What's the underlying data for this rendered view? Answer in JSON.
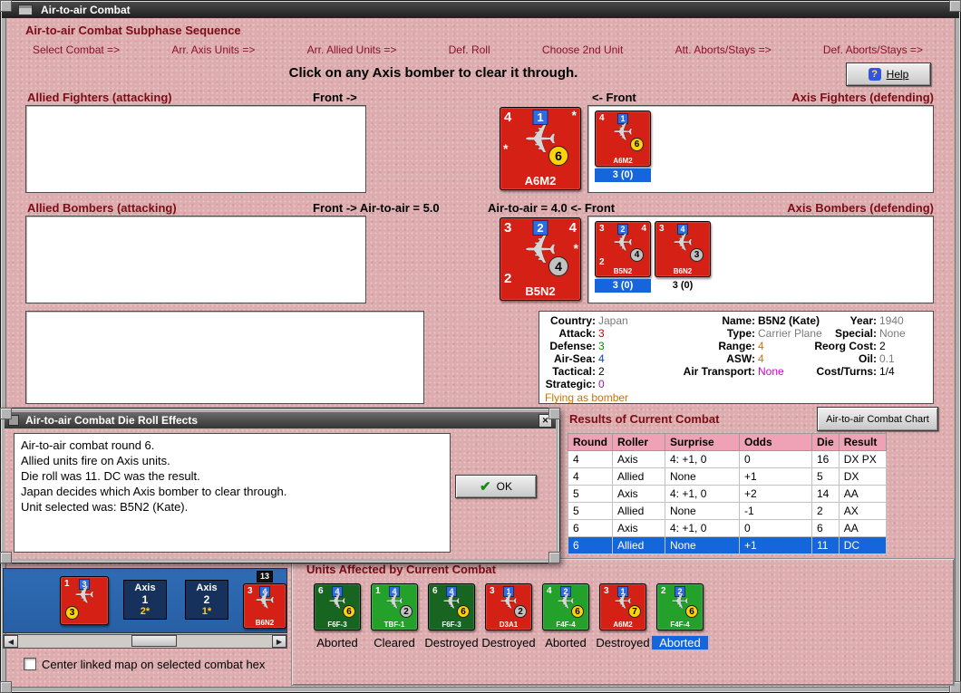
{
  "window": {
    "title": "Air-to-air Combat"
  },
  "colors": {
    "background_pink": "#dcacae",
    "maroon_text": "#7c0c16",
    "counter_red": "#d52015",
    "counter_green": "#23a12b",
    "counter_dark_green": "#176520",
    "marker_navy": "#16325c",
    "highlight_blue": "#1565dd",
    "table_header_pink": "#efa2b6",
    "circle_yellow": "#ffd20a",
    "circle_gray": "#c2c2c2",
    "stat_box_blue": "#2e6ce0",
    "map_blue": "#2d68b0"
  },
  "subphase": {
    "title": "Air-to-air Combat Subphase Sequence",
    "steps": [
      "Select Combat =>",
      "Arr. Axis Units =>",
      "Arr. Allied Units =>",
      "Def. Roll",
      "Choose 2nd Unit",
      "Att. Aborts/Stays =>",
      "Def. Aborts/Stays =>"
    ]
  },
  "banner": {
    "instruction": "Click on any Axis bomber to clear it through.",
    "help_label": "Help"
  },
  "fighter_row": {
    "allied_label": "Allied Fighters (attacking)",
    "front_label": "Front ->",
    "front_label_right": "<- Front",
    "axis_label": "Axis Fighters (defending)",
    "large_counter": {
      "name": "A6M2",
      "tl": "4",
      "box": "1",
      "circle": "6",
      "star": "*"
    },
    "axis_list": [
      {
        "name": "A6M2",
        "tl": "4",
        "box": "1",
        "circle": "6",
        "caption": "3 (0)",
        "selected": true
      }
    ]
  },
  "bomber_row": {
    "allied_label": "Allied Bombers (attacking)",
    "front_label": "Front ->  Air-to-air = 5.0",
    "front_label_right": "Air-to-air = 4.0  <- Front",
    "axis_label": "Axis Bombers (defending)",
    "large_counter": {
      "name": "B5N2",
      "tl": "3",
      "box": "2",
      "tr": "4",
      "bl": "2",
      "circle": "4",
      "star": "*"
    },
    "axis_list": [
      {
        "name": "B5N2",
        "tl": "3",
        "box": "2",
        "tr": "4",
        "bl": "2",
        "circle": "4",
        "caption": "3 (0)",
        "selected": true
      },
      {
        "name": "B6N2",
        "tl": "3",
        "box": "4",
        "circle": "3",
        "caption": "3 (0)",
        "selected": false
      }
    ]
  },
  "unit_info": {
    "col1": [
      {
        "label": "Country:",
        "value": "Japan",
        "color": "gray"
      },
      {
        "label": "Attack:",
        "value": "3",
        "color": "red"
      },
      {
        "label": "Defense:",
        "value": "3",
        "color": "green"
      },
      {
        "label": "Air-Sea:",
        "value": "4",
        "color": "blue"
      },
      {
        "label": "Tactical:",
        "value": "2",
        "color": "black"
      },
      {
        "label": "Strategic:",
        "value": "0",
        "color": "purple"
      }
    ],
    "col2": [
      {
        "label": "Name:",
        "value": "B5N2 (Kate)",
        "color": "bold"
      },
      {
        "label": "Type:",
        "value": "Carrier Plane",
        "color": "gray"
      },
      {
        "label": "Range:",
        "value": "4",
        "color": "orange"
      },
      {
        "label": "ASW:",
        "value": "4",
        "color": "orange"
      },
      {
        "label": "Air Transport:",
        "value": "None",
        "color": "magenta"
      }
    ],
    "col3": [
      {
        "label": "Year:",
        "value": "1940",
        "color": "gray"
      },
      {
        "label": "Special:",
        "value": "None",
        "color": "gray"
      },
      {
        "label": "Reorg Cost:",
        "value": "2",
        "color": "black"
      },
      {
        "label": "Oil:",
        "value": "0.1",
        "color": "gray"
      },
      {
        "label": "Cost/Turns:",
        "value": "1/4",
        "color": "black"
      }
    ],
    "footnote": "Flying as bomber"
  },
  "die_dialog": {
    "title": "Air-to-air Combat Die Roll Effects",
    "lines": [
      "Air-to-air combat round 6.",
      "Allied units fire on Axis units.",
      "Die roll was 11.  DC was the result.",
      "Japan decides which Axis bomber to clear through.",
      "Unit selected was: B5N2 (Kate)."
    ],
    "ok_label": "OK"
  },
  "results": {
    "title": "Results of Current Combat",
    "chart_button": "Air-to-air Combat Chart",
    "headers": [
      "Round",
      "Roller",
      "Surprise",
      "Odds",
      "Die",
      "Result"
    ],
    "rows": [
      [
        "4",
        "Axis",
        "4: +1, 0",
        "0",
        "16",
        "DX PX"
      ],
      [
        "4",
        "Allied",
        "None",
        "+1",
        "5",
        "DX"
      ],
      [
        "5",
        "Axis",
        "4: +1, 0",
        "+2",
        "14",
        "AA"
      ],
      [
        "5",
        "Allied",
        "None",
        "-1",
        "2",
        "AX"
      ],
      [
        "6",
        "Axis",
        "4: +1, 0",
        "0",
        "6",
        "AA"
      ],
      [
        "6",
        "Allied",
        "None",
        "+1",
        "11",
        "DC"
      ]
    ],
    "selected_row": 5
  },
  "map": {
    "counter1": {
      "tl": "1",
      "box": "3",
      "circle": "3"
    },
    "marker1": {
      "title": "Axis",
      "number": "1",
      "strength": "2*"
    },
    "marker2": {
      "title": "Axis",
      "number": "2",
      "strength": "1*"
    },
    "stack_badge": "13",
    "counter2": {
      "tl": "3",
      "box": "4",
      "name": "B6N2"
    }
  },
  "map_checkbox": "Center linked map on selected combat hex",
  "units_affected": {
    "title": "Units Affected by Current Combat",
    "units": [
      {
        "name": "F6F-3",
        "tl": "6",
        "box": "4",
        "circle": "6",
        "circle_color": "yellow",
        "color": "dark_green",
        "status": "Aborted",
        "selected": false
      },
      {
        "name": "TBF-1",
        "tl": "1",
        "box": "4",
        "circle": "2",
        "circle_color": "gray",
        "color": "green",
        "status": "Cleared",
        "selected": false
      },
      {
        "name": "F6F-3",
        "tl": "6",
        "box": "4",
        "circle": "6",
        "circle_color": "yellow",
        "color": "dark_green",
        "status": "Destroyed",
        "selected": false
      },
      {
        "name": "D3A1",
        "tl": "3",
        "box": "1",
        "circle": "2",
        "circle_color": "gray",
        "color": "red",
        "status": "Destroyed",
        "selected": false
      },
      {
        "name": "F4F-4",
        "tl": "4",
        "box": "2",
        "circle": "6",
        "circle_color": "yellow",
        "color": "green",
        "status": "Aborted",
        "selected": false
      },
      {
        "name": "A6M2",
        "tl": "3",
        "box": "1",
        "circle": "7",
        "circle_color": "yellow",
        "color": "red",
        "status": "Destroyed",
        "selected": false
      },
      {
        "name": "F4F-4",
        "tl": "2",
        "box": "2",
        "circle": "6",
        "circle_color": "yellow",
        "color": "green",
        "status": "Aborted",
        "selected": true
      }
    ]
  }
}
